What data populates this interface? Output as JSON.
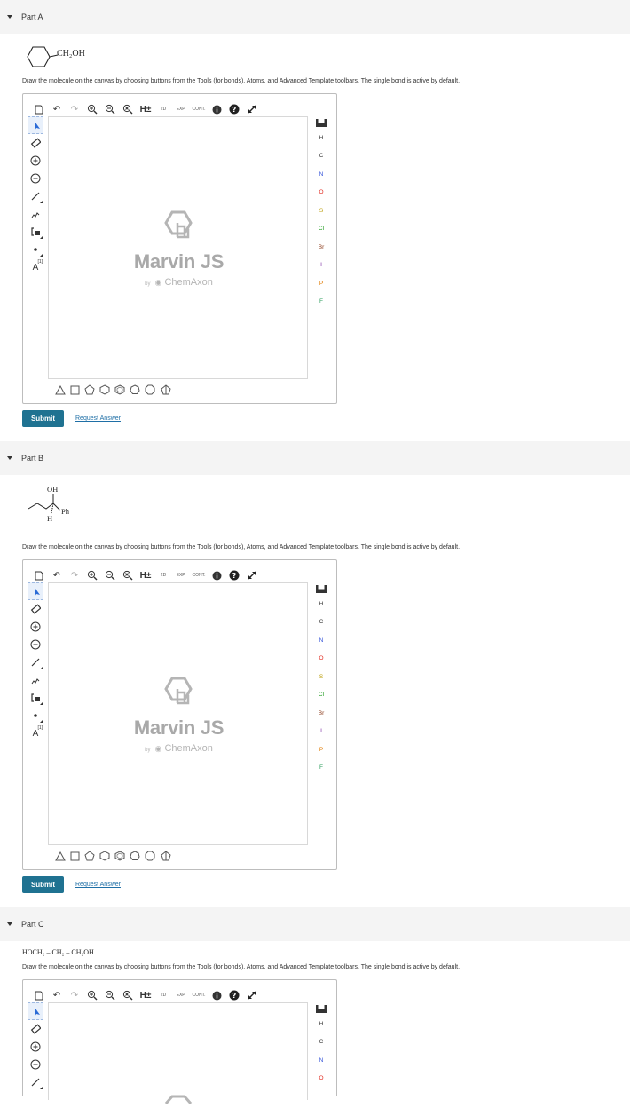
{
  "parts": [
    {
      "label": "Part A",
      "instruction": "Draw the molecule on the canvas by choosing buttons from the Tools (for bonds), Atoms, and Advanced Template toolbars. The single bond is active by default.",
      "molecule_text": "CH₂OH",
      "submit_label": "Submit",
      "request_label": "Request Answer"
    },
    {
      "label": "Part B",
      "instruction": "Draw the molecule on the canvas by choosing buttons from the Tools (for bonds), Atoms, and Advanced Template toolbars. The single bond is active by default.",
      "molecule_oh": "OH",
      "molecule_ph": "Ph",
      "molecule_h": "H",
      "submit_label": "Submit",
      "request_label": "Request Answer"
    },
    {
      "label": "Part C",
      "formula": "HOCH₂ – CH₂ – CH₂OH",
      "instruction": "Draw the molecule on the canvas by choosing buttons from the Tools (for bonds), Atoms, and Advanced Template toolbars. The single bond is active by default."
    }
  ],
  "editor": {
    "h_button": "H±",
    "toolbar_2d": "2D",
    "toolbar_exp": "EXP.",
    "toolbar_cont": "CONT.",
    "atom_charge_label": "A",
    "atom_map_label": "[1]",
    "watermark_title": "Marvin JS",
    "watermark_by": "by",
    "watermark_company": "ChemAxon",
    "atoms": [
      {
        "symbol": "H",
        "color": "#333333"
      },
      {
        "symbol": "C",
        "color": "#333333"
      },
      {
        "symbol": "N",
        "color": "#2f4fd8"
      },
      {
        "symbol": "O",
        "color": "#e0261b"
      },
      {
        "symbol": "S",
        "color": "#b89a00"
      },
      {
        "symbol": "Cl",
        "color": "#1f9c1f"
      },
      {
        "symbol": "Br",
        "color": "#8b3a1a"
      },
      {
        "symbol": "I",
        "color": "#7a2aa0"
      },
      {
        "symbol": "P",
        "color": "#e07a00"
      },
      {
        "symbol": "F",
        "color": "#2a9c5a"
      }
    ],
    "colors": {
      "submit_bg": "#1f7291",
      "link": "#1f6fa6",
      "header_bg": "#f4f4f4"
    }
  }
}
